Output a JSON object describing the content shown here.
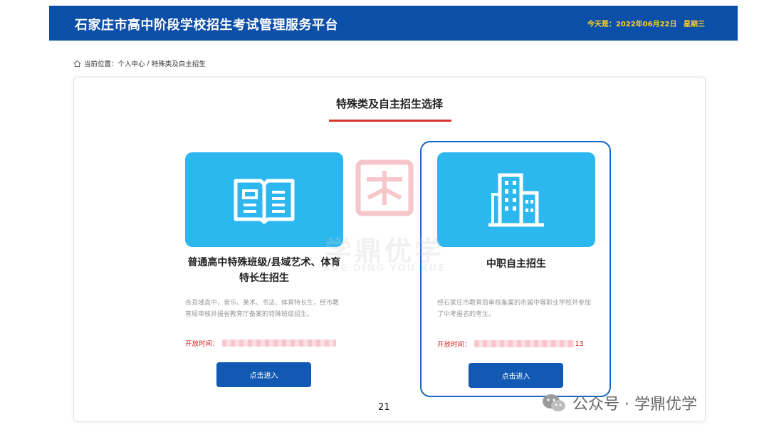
{
  "header": {
    "title": "石家庄市高中阶段学校招生考试管理服务平台",
    "date": "今天是：2022年06月22日",
    "weekday": "星期三"
  },
  "breadcrumb": {
    "prefix": "当前位置：",
    "items": [
      "个人中心",
      "特殊类及自主招生"
    ],
    "separator": "/"
  },
  "panel": {
    "title": "特殊类及自主招生选择",
    "accent_color": "#d9342b"
  },
  "cards": [
    {
      "title": "普通高中特殊班级/县域艺术、体育特长生招生",
      "description": "含县域高中，音乐、美术、书法、体育特长生，经市教育局审核并报省教育厅备案的特殊班级招生。",
      "open_time_label": "开放时间：",
      "open_time_tail": "",
      "button_label": "点击进入",
      "icon": "open-book-icon"
    },
    {
      "title": "中职自主招生",
      "description": "经石家庄市教育局审核备案的市属中等职业学校并参加了中考报名的考生。",
      "open_time_label": "开放时间：",
      "open_time_tail": "13",
      "button_label": "点击进入",
      "icon": "building-icon"
    }
  ],
  "watermark": {
    "text": "学鼎优学",
    "subtext": "XUE DING YOU XUE"
  },
  "page_number": "21",
  "wechat": {
    "text": "公众号 · 学鼎优学",
    "icon": "wechat-icon"
  },
  "colors": {
    "header_bg": "#0c4fa8",
    "date_text": "#ffd21f",
    "banner_bg": "#2db7ef",
    "button_bg": "#1159b3",
    "selected_border": "#1566c6",
    "open_time_text": "#dd2222"
  }
}
